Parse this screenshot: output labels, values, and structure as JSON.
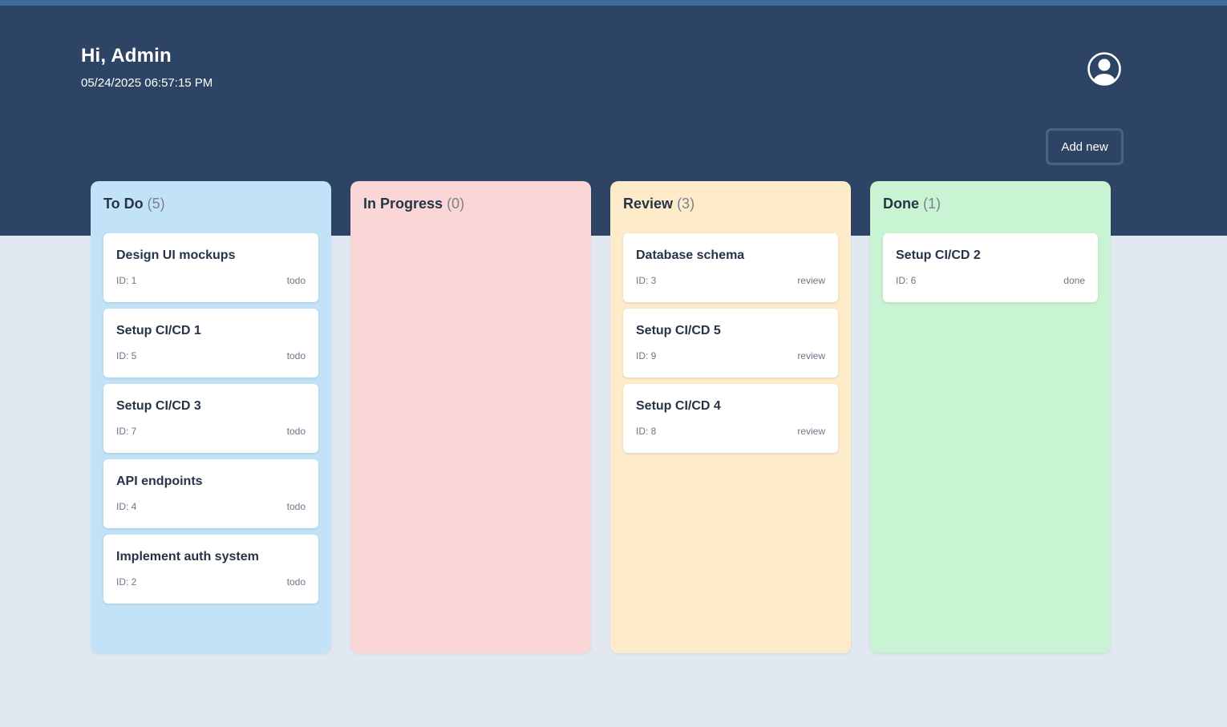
{
  "header": {
    "greeting": "Hi, Admin",
    "datetime": "05/24/2025 06:57:15 PM",
    "avatar_icon": "user-circle-icon",
    "add_new_label": "Add new"
  },
  "colors": {
    "header_bg": "#2e4465",
    "page_bg": "#e2e8f2",
    "todo_bg": "#c2e3f7",
    "in_progress_bg": "#fad6d6",
    "review_bg": "#feebca",
    "done_bg": "#c8f4d3"
  },
  "columns": [
    {
      "title": "To Do",
      "count": "(5)",
      "cards": [
        {
          "title": "Design UI mockups",
          "id": "ID: 1",
          "status": "todo"
        },
        {
          "title": "Setup CI/CD 1",
          "id": "ID: 5",
          "status": "todo"
        },
        {
          "title": "Setup CI/CD 3",
          "id": "ID: 7",
          "status": "todo"
        },
        {
          "title": "API endpoints",
          "id": "ID: 4",
          "status": "todo"
        },
        {
          "title": "Implement auth system",
          "id": "ID: 2",
          "status": "todo"
        }
      ]
    },
    {
      "title": "In Progress",
      "count": "(0)",
      "cards": []
    },
    {
      "title": "Review",
      "count": "(3)",
      "cards": [
        {
          "title": "Database schema",
          "id": "ID: 3",
          "status": "review"
        },
        {
          "title": "Setup CI/CD 5",
          "id": "ID: 9",
          "status": "review"
        },
        {
          "title": "Setup CI/CD 4",
          "id": "ID: 8",
          "status": "review"
        }
      ]
    },
    {
      "title": "Done",
      "count": "(1)",
      "cards": [
        {
          "title": "Setup CI/CD 2",
          "id": "ID: 6",
          "status": "done"
        }
      ]
    }
  ]
}
